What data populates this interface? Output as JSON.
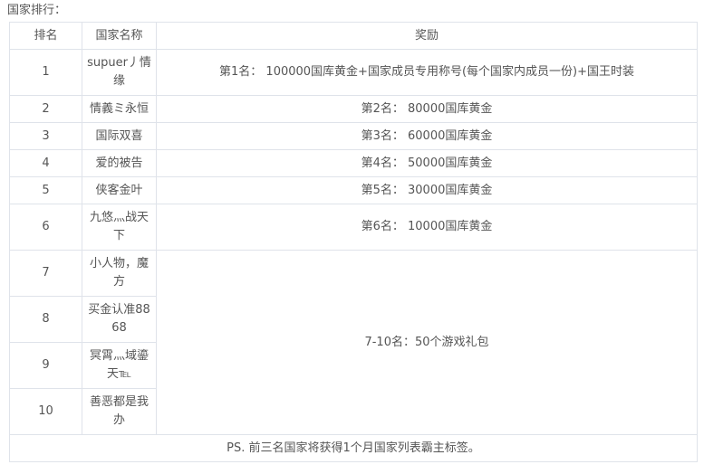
{
  "heading": "国家排行：",
  "headers": {
    "rank": "排名",
    "name": "国家名称",
    "reward": "奖励"
  },
  "rows": [
    {
      "rank": "1",
      "name": "supuer丿情缘",
      "reward": "第1名： 100000国库黄金+国家成员专用称号(每个国家内成员一份)+国王时装"
    },
    {
      "rank": "2",
      "name": "情義ミ永恒",
      "reward": "第2名： 80000国库黄金"
    },
    {
      "rank": "3",
      "name": "国际双喜",
      "reward": "第3名： 60000国库黄金"
    },
    {
      "rank": "4",
      "name": "爱的被告",
      "reward": "第4名： 50000国库黄金"
    },
    {
      "rank": "5",
      "name": "侠客金叶",
      "reward": "第5名： 30000国库黄金"
    },
    {
      "rank": "6",
      "name": "九悠灬战天下",
      "reward": "第6名： 10000国库黄金"
    },
    {
      "rank": "7",
      "name": "小人物，魔方"
    },
    {
      "rank": "8",
      "name": "买金认准8868"
    },
    {
      "rank": "9",
      "name": "冥霄灬域鎏天℡"
    },
    {
      "rank": "10",
      "name": "善恶都是我办"
    }
  ],
  "group_reward": "7-10名：50个游戏礼包",
  "footer": "PS. 前三名国家将获得1个月国家列表霸主标签。"
}
